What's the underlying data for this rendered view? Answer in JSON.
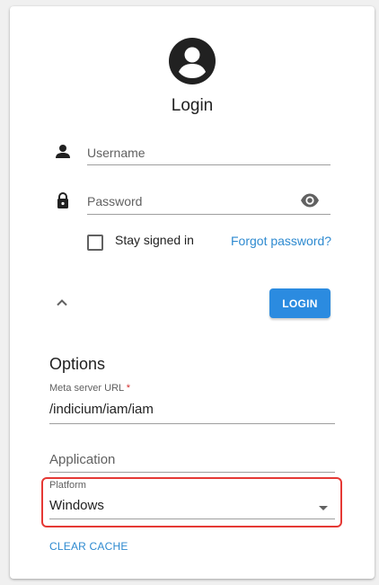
{
  "login": {
    "title": "Login",
    "username_placeholder": "Username",
    "password_placeholder": "Password",
    "stay_signed_in_label": "Stay signed in",
    "stay_signed_in_checked": false,
    "forgot_password_label": "Forgot password?",
    "login_button_label": "LOGIN"
  },
  "options": {
    "title": "Options",
    "meta_server_url_label": "Meta server URL",
    "required_marker": "*",
    "meta_server_url_value": "/indicium/iam/iam",
    "application_placeholder": "Application",
    "platform_label": "Platform",
    "platform_value": "Windows",
    "clear_cache_label": "CLEAR CACHE"
  },
  "icons": {
    "avatar": "account-circle-icon",
    "user": "person-icon",
    "lock": "lock-icon",
    "eye": "visibility-icon",
    "collapse": "chevron-up-icon",
    "dropdown": "caret-down-icon"
  },
  "colors": {
    "accent": "#2b8be0",
    "link": "#2e8ad0",
    "highlight": "#e53935",
    "required": "#d32f2f"
  }
}
